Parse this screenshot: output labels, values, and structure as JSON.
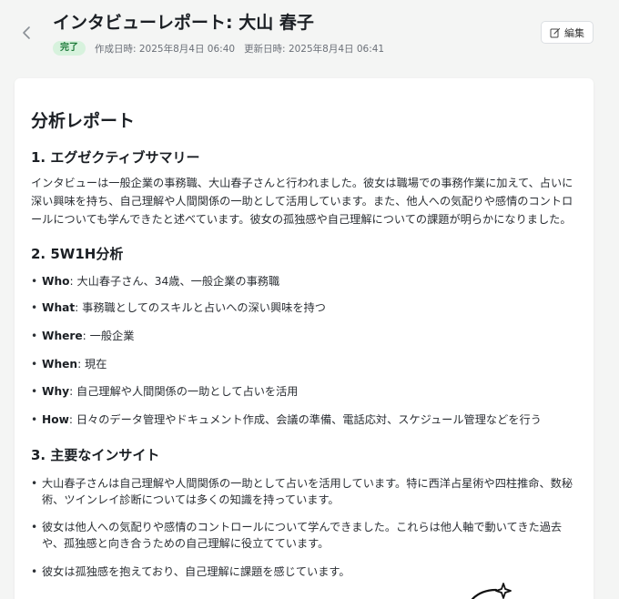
{
  "header": {
    "back_icon": "chevron-left-icon",
    "title": "インタビューレポート: 大山 春子",
    "status": "完了",
    "created": "作成日時: 2025年8月4日 06:40",
    "updated": "更新日時: 2025年8月4日 06:41",
    "edit_label": "編集",
    "edit_icon": "edit-icon",
    "status_color": "#1e7a3a"
  },
  "report": {
    "title": "分析レポート",
    "sections": {
      "summary": {
        "heading": "1. エグゼクティブサマリー",
        "body": "インタビューは一般企業の事務職、大山春子さんと行われました。彼女は職場での事務作業に加えて、占いに深い興味を持ち、自己理解や人間関係の一助として活用しています。また、他人への気配りや感情のコントロールについても学んできたと述べています。彼女の孤独感や自己理解についての課題が明らかになりました。"
      },
      "w5h1": {
        "heading": "2. 5W1H分析",
        "items": [
          {
            "key": "Who",
            "value": ": 大山春子さん、34歳、一般企業の事務職"
          },
          {
            "key": "What",
            "value": ": 事務職としてのスキルと占いへの深い興味を持つ"
          },
          {
            "key": "Where",
            "value": ": 一般企業"
          },
          {
            "key": "When",
            "value": ": 現在"
          },
          {
            "key": "Why",
            "value": ": 自己理解や人間関係の一助として占いを活用"
          },
          {
            "key": "How",
            "value": ": 日々のデータ管理やドキュメント作成、会議の準備、電話応対、スケジュール管理などを行う"
          }
        ]
      },
      "insights": {
        "heading": "3. 主要なインサイト",
        "items": [
          "大山春子さんは自己理解や人間関係の一助として占いを活用しています。特に西洋占星術や四柱推命、数秘術、ツインレイ診断については多くの知識を持っています。",
          "彼女は他人への気配りや感情のコントロールについて学んできました。これらは他人軸で動いてきた過去や、孤独感と向き合うための自己理解に役立てています。",
          "彼女は孤独感を抱えており、自己理解に課題を感じています。"
        ]
      }
    }
  }
}
